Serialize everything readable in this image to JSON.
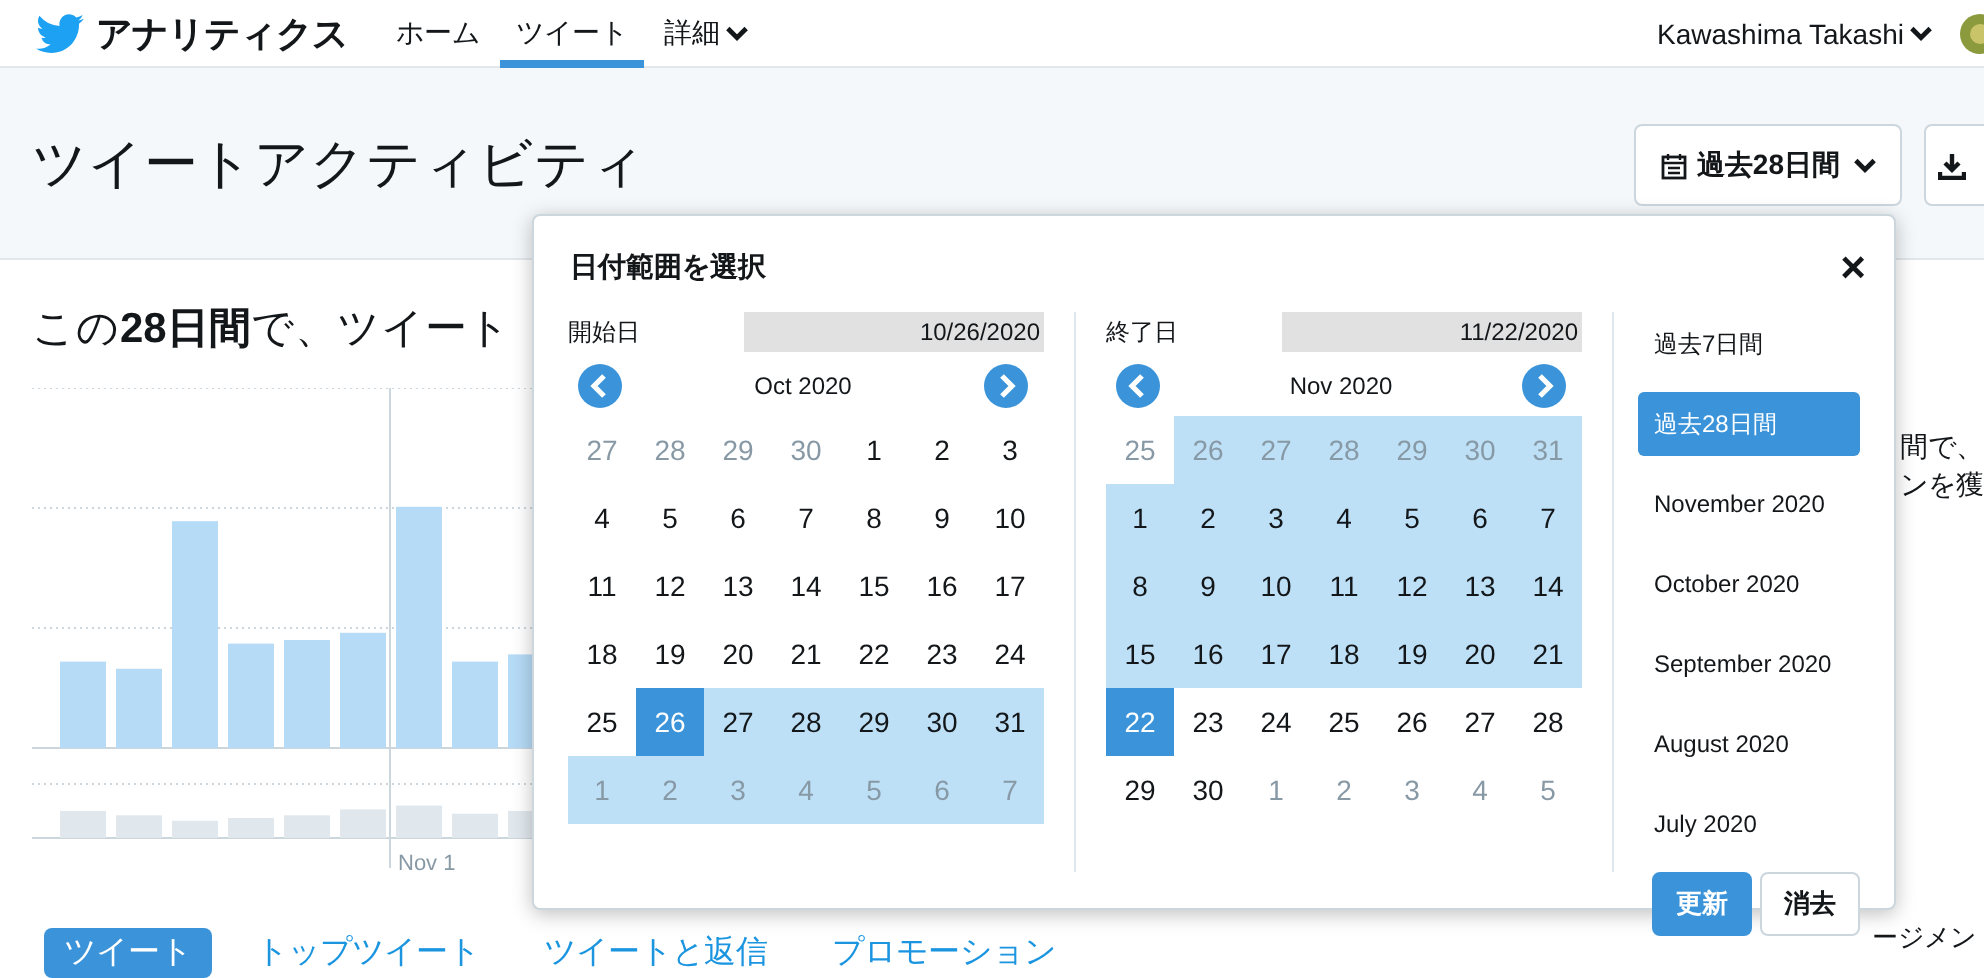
{
  "header": {
    "brand": "アナリティクス",
    "nav": [
      {
        "label": "ホーム",
        "selected": false,
        "dropdown": false
      },
      {
        "label": "ツイート",
        "selected": true,
        "dropdown": false
      },
      {
        "label": "詳細",
        "selected": false,
        "dropdown": true
      }
    ],
    "user": "Kawashima Takashi"
  },
  "page": {
    "title": "ツイートアクティビティ",
    "range_button": "過去28日間",
    "summary": "この**28日間**で、ツイート",
    "chart_label": "Nov 1",
    "side_text": [
      "間で、",
      "ンを獲"
    ],
    "tabs": [
      {
        "label": "ツイート",
        "selected": true
      },
      {
        "label": "トップツイート",
        "selected": false
      },
      {
        "label": "ツイートと返信",
        "selected": false
      },
      {
        "label": "プロモーション",
        "selected": false
      }
    ],
    "side_footer": "ージメン"
  },
  "date_picker": {
    "title": "日付範囲を選択",
    "close": "×",
    "calendars": [
      {
        "label": "開始日",
        "value": "10/26/2020",
        "month": "Oct 2020",
        "weeks": [
          [
            {
              "d": "27",
              "muted": true,
              "in_range": false,
              "selected": false
            },
            {
              "d": "28",
              "muted": true,
              "in_range": false,
              "selected": false
            },
            {
              "d": "29",
              "muted": true,
              "in_range": false,
              "selected": false
            },
            {
              "d": "30",
              "muted": true,
              "in_range": false,
              "selected": false
            },
            {
              "d": "1",
              "muted": false,
              "in_range": false,
              "selected": false
            },
            {
              "d": "2",
              "muted": false,
              "in_range": false,
              "selected": false
            },
            {
              "d": "3",
              "muted": false,
              "in_range": false,
              "selected": false
            }
          ],
          [
            {
              "d": "4",
              "muted": false,
              "in_range": false,
              "selected": false
            },
            {
              "d": "5",
              "muted": false,
              "in_range": false,
              "selected": false
            },
            {
              "d": "6",
              "muted": false,
              "in_range": false,
              "selected": false
            },
            {
              "d": "7",
              "muted": false,
              "in_range": false,
              "selected": false
            },
            {
              "d": "8",
              "muted": false,
              "in_range": false,
              "selected": false
            },
            {
              "d": "9",
              "muted": false,
              "in_range": false,
              "selected": false
            },
            {
              "d": "10",
              "muted": false,
              "in_range": false,
              "selected": false
            }
          ],
          [
            {
              "d": "11",
              "muted": false,
              "in_range": false,
              "selected": false
            },
            {
              "d": "12",
              "muted": false,
              "in_range": false,
              "selected": false
            },
            {
              "d": "13",
              "muted": false,
              "in_range": false,
              "selected": false
            },
            {
              "d": "14",
              "muted": false,
              "in_range": false,
              "selected": false
            },
            {
              "d": "15",
              "muted": false,
              "in_range": false,
              "selected": false
            },
            {
              "d": "16",
              "muted": false,
              "in_range": false,
              "selected": false
            },
            {
              "d": "17",
              "muted": false,
              "in_range": false,
              "selected": false
            }
          ],
          [
            {
              "d": "18",
              "muted": false,
              "in_range": false,
              "selected": false
            },
            {
              "d": "19",
              "muted": false,
              "in_range": false,
              "selected": false
            },
            {
              "d": "20",
              "muted": false,
              "in_range": false,
              "selected": false
            },
            {
              "d": "21",
              "muted": false,
              "in_range": false,
              "selected": false
            },
            {
              "d": "22",
              "muted": false,
              "in_range": false,
              "selected": false
            },
            {
              "d": "23",
              "muted": false,
              "in_range": false,
              "selected": false
            },
            {
              "d": "24",
              "muted": false,
              "in_range": false,
              "selected": false
            }
          ],
          [
            {
              "d": "25",
              "muted": false,
              "in_range": false,
              "selected": false
            },
            {
              "d": "26",
              "muted": false,
              "in_range": true,
              "selected": true
            },
            {
              "d": "27",
              "muted": false,
              "in_range": true,
              "selected": false
            },
            {
              "d": "28",
              "muted": false,
              "in_range": true,
              "selected": false
            },
            {
              "d": "29",
              "muted": false,
              "in_range": true,
              "selected": false
            },
            {
              "d": "30",
              "muted": false,
              "in_range": true,
              "selected": false
            },
            {
              "d": "31",
              "muted": false,
              "in_range": true,
              "selected": false
            }
          ],
          [
            {
              "d": "1",
              "muted": true,
              "in_range": true,
              "selected": false
            },
            {
              "d": "2",
              "muted": true,
              "in_range": true,
              "selected": false
            },
            {
              "d": "3",
              "muted": true,
              "in_range": true,
              "selected": false
            },
            {
              "d": "4",
              "muted": true,
              "in_range": true,
              "selected": false
            },
            {
              "d": "5",
              "muted": true,
              "in_range": true,
              "selected": false
            },
            {
              "d": "6",
              "muted": true,
              "in_range": true,
              "selected": false
            },
            {
              "d": "7",
              "muted": true,
              "in_range": true,
              "selected": false
            }
          ]
        ]
      },
      {
        "label": "終了日",
        "value": "11/22/2020",
        "month": "Nov 2020",
        "weeks": [
          [
            {
              "d": "25",
              "muted": true,
              "in_range": false,
              "selected": false
            },
            {
              "d": "26",
              "muted": true,
              "in_range": true,
              "selected": false
            },
            {
              "d": "27",
              "muted": true,
              "in_range": true,
              "selected": false
            },
            {
              "d": "28",
              "muted": true,
              "in_range": true,
              "selected": false
            },
            {
              "d": "29",
              "muted": true,
              "in_range": true,
              "selected": false
            },
            {
              "d": "30",
              "muted": true,
              "in_range": true,
              "selected": false
            },
            {
              "d": "31",
              "muted": true,
              "in_range": true,
              "selected": false
            }
          ],
          [
            {
              "d": "1",
              "muted": false,
              "in_range": true,
              "selected": false
            },
            {
              "d": "2",
              "muted": false,
              "in_range": true,
              "selected": false
            },
            {
              "d": "3",
              "muted": false,
              "in_range": true,
              "selected": false
            },
            {
              "d": "4",
              "muted": false,
              "in_range": true,
              "selected": false
            },
            {
              "d": "5",
              "muted": false,
              "in_range": true,
              "selected": false
            },
            {
              "d": "6",
              "muted": false,
              "in_range": true,
              "selected": false
            },
            {
              "d": "7",
              "muted": false,
              "in_range": true,
              "selected": false
            }
          ],
          [
            {
              "d": "8",
              "muted": false,
              "in_range": true,
              "selected": false
            },
            {
              "d": "9",
              "muted": false,
              "in_range": true,
              "selected": false
            },
            {
              "d": "10",
              "muted": false,
              "in_range": true,
              "selected": false
            },
            {
              "d": "11",
              "muted": false,
              "in_range": true,
              "selected": false
            },
            {
              "d": "12",
              "muted": false,
              "in_range": true,
              "selected": false
            },
            {
              "d": "13",
              "muted": false,
              "in_range": true,
              "selected": false
            },
            {
              "d": "14",
              "muted": false,
              "in_range": true,
              "selected": false
            }
          ],
          [
            {
              "d": "15",
              "muted": false,
              "in_range": true,
              "selected": false
            },
            {
              "d": "16",
              "muted": false,
              "in_range": true,
              "selected": false
            },
            {
              "d": "17",
              "muted": false,
              "in_range": true,
              "selected": false
            },
            {
              "d": "18",
              "muted": false,
              "in_range": true,
              "selected": false
            },
            {
              "d": "19",
              "muted": false,
              "in_range": true,
              "selected": false
            },
            {
              "d": "20",
              "muted": false,
              "in_range": true,
              "selected": false
            },
            {
              "d": "21",
              "muted": false,
              "in_range": true,
              "selected": false
            }
          ],
          [
            {
              "d": "22",
              "muted": false,
              "in_range": true,
              "selected": true
            },
            {
              "d": "23",
              "muted": false,
              "in_range": false,
              "selected": false
            },
            {
              "d": "24",
              "muted": false,
              "in_range": false,
              "selected": false
            },
            {
              "d": "25",
              "muted": false,
              "in_range": false,
              "selected": false
            },
            {
              "d": "26",
              "muted": false,
              "in_range": false,
              "selected": false
            },
            {
              "d": "27",
              "muted": false,
              "in_range": false,
              "selected": false
            },
            {
              "d": "28",
              "muted": false,
              "in_range": false,
              "selected": false
            }
          ],
          [
            {
              "d": "29",
              "muted": false,
              "in_range": false,
              "selected": false
            },
            {
              "d": "30",
              "muted": false,
              "in_range": false,
              "selected": false
            },
            {
              "d": "1",
              "muted": true,
              "in_range": false,
              "selected": false
            },
            {
              "d": "2",
              "muted": true,
              "in_range": false,
              "selected": false
            },
            {
              "d": "3",
              "muted": true,
              "in_range": false,
              "selected": false
            },
            {
              "d": "4",
              "muted": true,
              "in_range": false,
              "selected": false
            },
            {
              "d": "5",
              "muted": true,
              "in_range": false,
              "selected": false
            }
          ]
        ]
      }
    ],
    "presets": [
      {
        "label": "過去7日間",
        "selected": false
      },
      {
        "label": "過去28日間",
        "selected": true
      },
      {
        "label": "November 2020",
        "selected": false
      },
      {
        "label": "October 2020",
        "selected": false
      },
      {
        "label": "September 2020",
        "selected": false
      },
      {
        "label": "August 2020",
        "selected": false
      },
      {
        "label": "July 2020",
        "selected": false
      }
    ],
    "buttons": [
      {
        "label": "更新",
        "kind": "primary"
      },
      {
        "label": "消去",
        "kind": "secondary"
      }
    ]
  }
}
